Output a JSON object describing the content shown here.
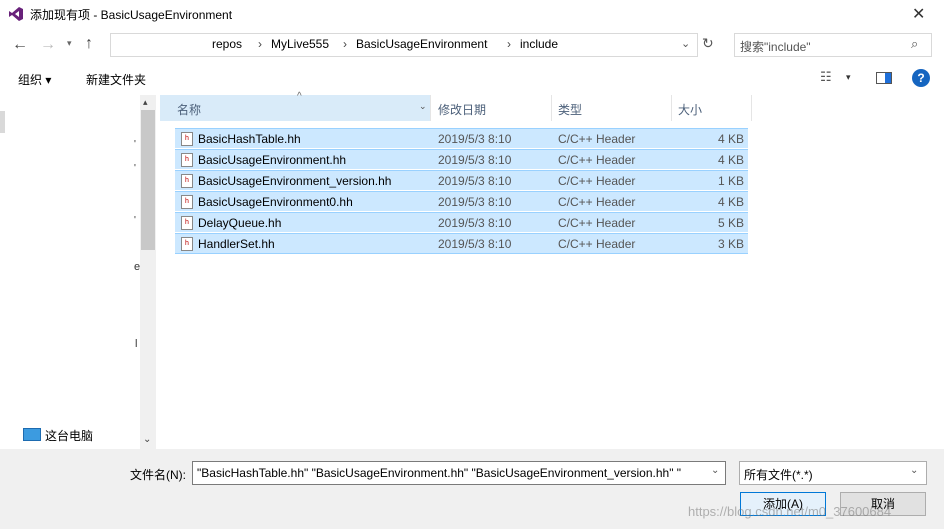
{
  "window": {
    "title": "添加现有项 - BasicUsageEnvironment",
    "close_glyph": "✕"
  },
  "address": {
    "crumbs": [
      "repos",
      "MyLive555",
      "BasicUsageEnvironment",
      "include"
    ],
    "separator": "›",
    "search_placeholder": "搜索\"include\""
  },
  "toolbar": {
    "organize_label": "组织 ▾",
    "new_folder_label": "新建文件夹"
  },
  "navpane": {
    "this_pc_label": "这台电脑",
    "edge_marks": [
      "'",
      "'",
      "'",
      "e",
      "l"
    ]
  },
  "columns": {
    "name": "名称",
    "date": "修改日期",
    "type": "类型",
    "size": "大小"
  },
  "files": [
    {
      "name": "BasicHashTable.hh",
      "date": "2019/5/3 8:10",
      "type": "C/C++ Header",
      "size": "4 KB"
    },
    {
      "name": "BasicUsageEnvironment.hh",
      "date": "2019/5/3 8:10",
      "type": "C/C++ Header",
      "size": "4 KB"
    },
    {
      "name": "BasicUsageEnvironment_version.hh",
      "date": "2019/5/3 8:10",
      "type": "C/C++ Header",
      "size": "1 KB"
    },
    {
      "name": "BasicUsageEnvironment0.hh",
      "date": "2019/5/3 8:10",
      "type": "C/C++ Header",
      "size": "4 KB"
    },
    {
      "name": "DelayQueue.hh",
      "date": "2019/5/3 8:10",
      "type": "C/C++ Header",
      "size": "5 KB"
    },
    {
      "name": "HandlerSet.hh",
      "date": "2019/5/3 8:10",
      "type": "C/C++ Header",
      "size": "3 KB"
    }
  ],
  "bottom": {
    "filename_label": "文件名(N):",
    "filename_value": "\"BasicHashTable.hh\" \"BasicUsageEnvironment.hh\" \"BasicUsageEnvironment_version.hh\" \"",
    "filetype_value": "所有文件(*.*)",
    "add_button": "添加(A)",
    "cancel_button": "取消",
    "watermark": "https://blog.csdn.net/m0_37600684"
  },
  "colors": {
    "selected_row": "#cce8ff",
    "selected_border": "#99d1ff",
    "accent": "#0078d7"
  }
}
